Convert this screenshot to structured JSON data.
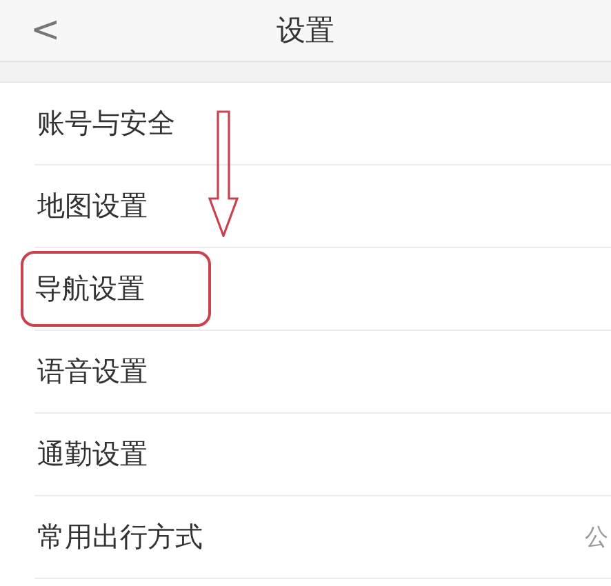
{
  "header": {
    "back": "<",
    "title": "设置"
  },
  "items": [
    {
      "label": "账号与安全",
      "highlighted": false
    },
    {
      "label": "地图设置",
      "highlighted": false
    },
    {
      "label": "导航设置",
      "highlighted": true
    },
    {
      "label": "语音设置",
      "highlighted": false
    },
    {
      "label": "通勤设置",
      "highlighted": false
    },
    {
      "label": "常用出行方式",
      "value": "公",
      "highlighted": false
    }
  ]
}
